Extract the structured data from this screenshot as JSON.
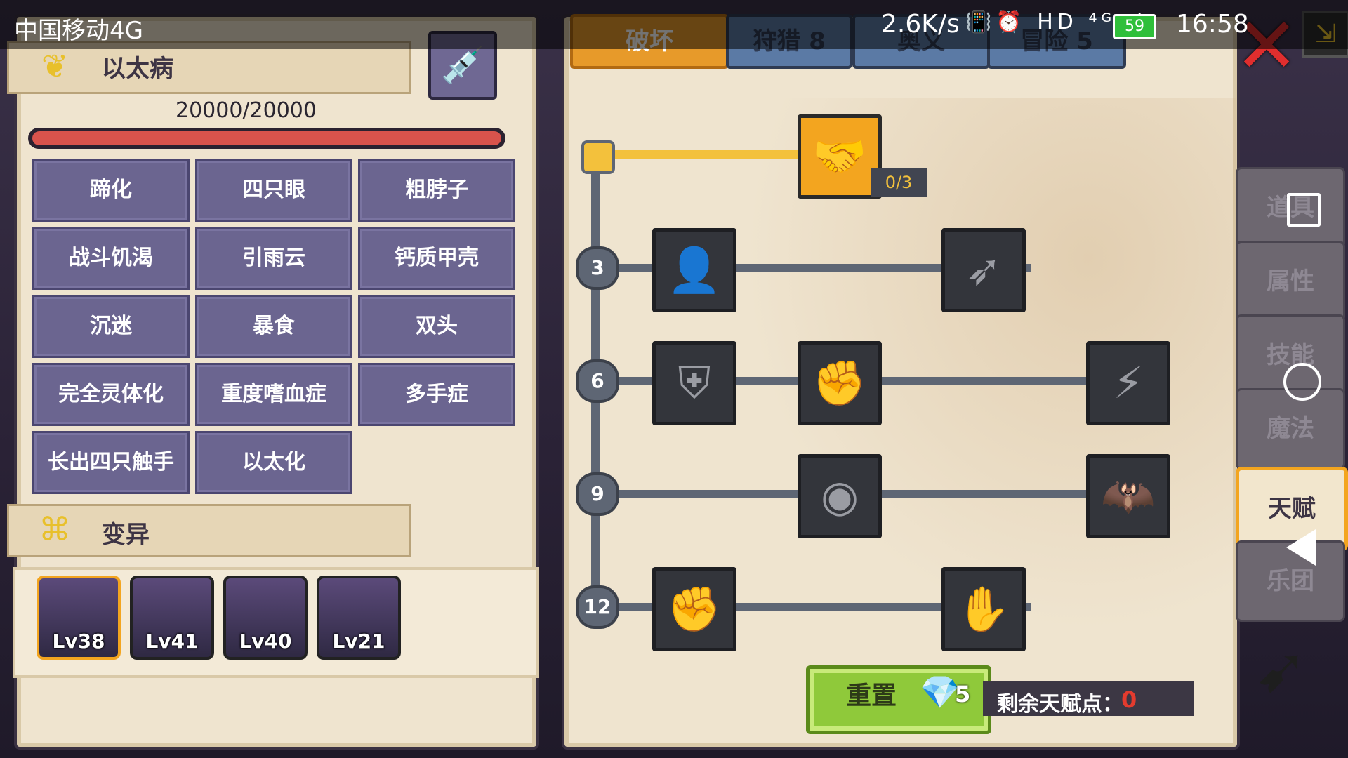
{
  "status_bar": {
    "carrier": "中国移动4G",
    "speed": "2.6K/s",
    "icons": "📳⏰ HD ⁴ᴳ.ıl",
    "battery": "59",
    "time": "16:58"
  },
  "disease": {
    "title": "以太病",
    "icon": "ether-icon",
    "hp_text": "20000/20000",
    "hp_fraction": 1.0,
    "hp_color": "#d9534c",
    "traits": [
      "蹄化",
      "四只眼",
      "粗脖子",
      "战斗饥渴",
      "引雨云",
      "钙质甲壳",
      "沉迷",
      "暴食",
      "双头",
      "完全灵体化",
      "重度嗜血症",
      "多手症",
      "长出四只触手",
      "以太化"
    ]
  },
  "mutation": {
    "title": "变异",
    "icon": "dna-icon",
    "characters": [
      {
        "level": "Lv38",
        "selected": true
      },
      {
        "level": "Lv41",
        "selected": false
      },
      {
        "level": "Lv40",
        "selected": false
      },
      {
        "level": "Lv21",
        "selected": false
      }
    ]
  },
  "talent": {
    "tabs": [
      {
        "label": "破坏",
        "active": true
      },
      {
        "label": "狩猎 8",
        "active": false
      },
      {
        "label": "奥义",
        "active": false
      },
      {
        "label": "冒险 5",
        "active": false
      }
    ],
    "levels": [
      "3",
      "6",
      "9",
      "12"
    ],
    "first_node_progress": "0/3",
    "nodes": [
      {
        "icon": "arm-wrestle-icon",
        "glyph": "🤝"
      },
      {
        "icon": "body-icon",
        "glyph": "👤"
      },
      {
        "icon": "arrow-icon",
        "glyph": "➶"
      },
      {
        "icon": "shield-crack-icon",
        "glyph": "⛨"
      },
      {
        "icon": "fist-punch-icon",
        "glyph": "✊"
      },
      {
        "icon": "slash-icon",
        "glyph": "⚡"
      },
      {
        "icon": "ripple-icon",
        "glyph": "◉"
      },
      {
        "icon": "bat-icon",
        "glyph": "🦇"
      },
      {
        "icon": "fist-icon",
        "glyph": "✊"
      },
      {
        "icon": "grip-icon",
        "glyph": "✋"
      }
    ],
    "reset_label": "重置",
    "reset_cost": "5",
    "remaining_label": "剩余天赋点：",
    "remaining_value": "0"
  },
  "side_tabs": [
    {
      "label": "道具",
      "active": false
    },
    {
      "label": "属性",
      "active": false
    },
    {
      "label": "技能",
      "active": false
    },
    {
      "label": "魔法",
      "active": false
    },
    {
      "label": "天赋",
      "active": true
    },
    {
      "label": "乐团",
      "active": false
    }
  ],
  "colors": {
    "accent": "#f3a51f",
    "trait_bg": "#6b6590",
    "reset_green": "#8fc93a",
    "remaining_red": "#e33b2e"
  }
}
